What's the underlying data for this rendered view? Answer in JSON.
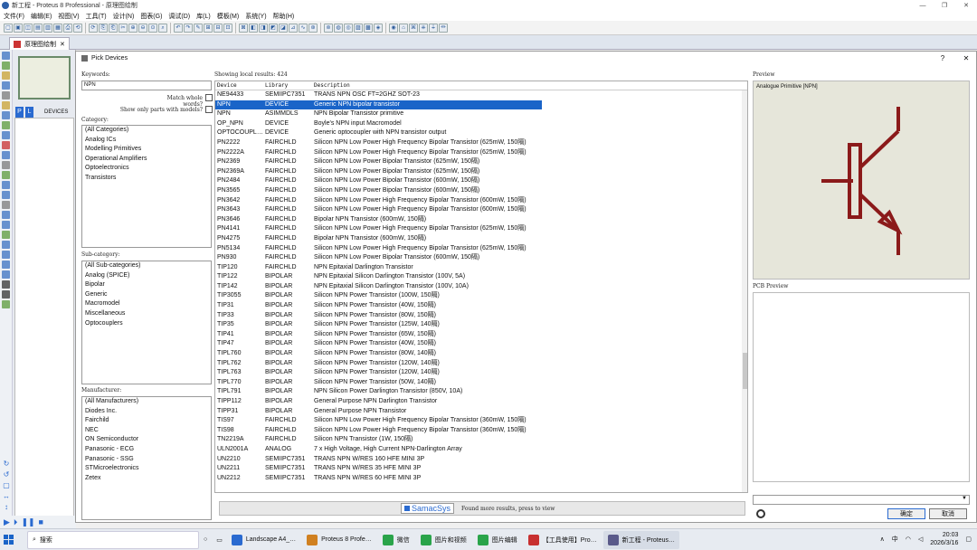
{
  "window": {
    "title": "新工程 - Proteus 8 Professional - 原理图绘制"
  },
  "menu": [
    "文件(F)",
    "编辑(E)",
    "视图(V)",
    "工具(T)",
    "设计(N)",
    "图表(G)",
    "调试(D)",
    "库(L)",
    "模板(M)",
    "系统(Y)",
    "帮助(H)"
  ],
  "tab": {
    "label": "原理图绘制"
  },
  "left": {
    "p_btn": "P",
    "l_btn": "L",
    "devices_label": "DEVICES"
  },
  "dialog": {
    "title": "Pick Devices",
    "help": "?",
    "keywords_label": "Keywords:",
    "keywords_value": "NPN",
    "match_whole": "Match whole words?",
    "show_models": "Show only parts with models?",
    "category_label": "Category:",
    "categories": [
      "(All Categories)",
      "Analog ICs",
      "Modelling Primitives",
      "Operational Amplifiers",
      "Optoelectronics",
      "Transistors"
    ],
    "subcategory_label": "Sub-category:",
    "subcategories": [
      "(All Sub-categories)",
      "Analog (SPICE)",
      "Bipolar",
      "Generic",
      "Macromodel",
      "Miscellaneous",
      "Optocouplers"
    ],
    "manufacturer_label": "Manufacturer:",
    "manufacturers": [
      "(All Manufacturers)",
      "Diodes Inc.",
      "Fairchild",
      "NEC",
      "ON Semiconductor",
      "Panasonic - ECG",
      "Panasonic - SSG",
      "STMicroelectronics",
      "Zetex"
    ],
    "results_label": "Showing local results: 424",
    "col_device": "Device",
    "col_library": "Library",
    "col_description": "Description",
    "rows": [
      [
        "NE94433",
        "SEMIIPC7351",
        "TRANS NPN OSC FT=2GHZ SOT-23"
      ],
      [
        "NPN",
        "DEVICE",
        "Generic NPN bipolar transistor"
      ],
      [
        "NPN",
        "ASIMMDLS",
        "NPN Bipolar Transistor primitive"
      ],
      [
        "OP_NPN",
        "DEVICE",
        "Boyle's NPN input Macromodel"
      ],
      [
        "OPTOCOUPL…",
        "DEVICE",
        "Generic optocoupler with NPN transistor output"
      ],
      [
        "PN2222",
        "FAIRCHLD",
        "Silicon NPN Low Power High Frequency Bipolar Transistor (625mW, 150隔)"
      ],
      [
        "PN2222A",
        "FAIRCHLD",
        "Silicon NPN Low Power High Frequency Bipolar Transistor (625mW, 150隔)"
      ],
      [
        "PN2369",
        "FAIRCHLD",
        "Silicon NPN Low Power Bipolar Transistor (625mW, 150隔)"
      ],
      [
        "PN2369A",
        "FAIRCHLD",
        "Silicon NPN Low Power Bipolar Transistor (625mW, 150隔)"
      ],
      [
        "PN2484",
        "FAIRCHLD",
        "Silicon NPN Low Power Bipolar Transistor (600mW, 150隔)"
      ],
      [
        "PN3565",
        "FAIRCHLD",
        "Silicon NPN Low Power Bipolar Transistor (600mW, 150隔)"
      ],
      [
        "PN3642",
        "FAIRCHLD",
        "Silicon NPN Low Power High Frequency Bipolar Transistor (600mW, 150隔)"
      ],
      [
        "PN3643",
        "FAIRCHLD",
        "Silicon NPN Low Power High Frequency Bipolar Transistor (600mW, 150隔)"
      ],
      [
        "PN3646",
        "FAIRCHLD",
        "Bipolar NPN Transistor (600mW, 150隔)"
      ],
      [
        "PN4141",
        "FAIRCHLD",
        "Silicon NPN Low Power High Frequency Bipolar Transistor (625mW, 150隔)"
      ],
      [
        "PN4275",
        "FAIRCHLD",
        "Bipolar NPN Transistor (600mW, 150隔)"
      ],
      [
        "PN5134",
        "FAIRCHLD",
        "Silicon NPN Low Power High Frequency Bipolar Transistor (625mW, 150隔)"
      ],
      [
        "PN930",
        "FAIRCHLD",
        "Silicon NPN Low Power Bipolar Transistor (600mW, 150隔)"
      ],
      [
        "TIP120",
        "FAIRCHLD",
        "NPN Epitaxial Darlington Transistor"
      ],
      [
        "TIP122",
        "BIPOLAR",
        "NPN Epitaxial Silicon Darlington Transistor (100V, 5A)"
      ],
      [
        "TIP142",
        "BIPOLAR",
        "NPN Epitaxial Silicon Darlington Transistor (100V, 10A)"
      ],
      [
        "TIP3055",
        "BIPOLAR",
        "Silicon NPN Power Transistor (100W, 150隔)"
      ],
      [
        "TIP31",
        "BIPOLAR",
        "Silicon NPN Power Transistor (40W, 150隔)"
      ],
      [
        "TIP33",
        "BIPOLAR",
        "Silicon NPN Power Transistor (80W, 150隔)"
      ],
      [
        "TIP35",
        "BIPOLAR",
        "Silicon NPN Power Transistor (125W, 140隔)"
      ],
      [
        "TIP41",
        "BIPOLAR",
        "Silicon NPN Power Transistor (65W, 150隔)"
      ],
      [
        "TIP47",
        "BIPOLAR",
        "Silicon NPN Power Transistor (40W, 150隔)"
      ],
      [
        "TIPL760",
        "BIPOLAR",
        "Silicon NPN Power Transistor (80W, 140隔)"
      ],
      [
        "TIPL762",
        "BIPOLAR",
        "Silicon NPN Power Transistor (120W, 140隔)"
      ],
      [
        "TIPL763",
        "BIPOLAR",
        "Silicon NPN Power Transistor (120W, 140隔)"
      ],
      [
        "TIPL770",
        "BIPOLAR",
        "Silicon NPN Power Transistor (50W, 140隔)"
      ],
      [
        "TIPL791",
        "BIPOLAR",
        "NPN Silicon Power Darlington Transistor (850V, 10A)"
      ],
      [
        "TIPP112",
        "BIPOLAR",
        "General Purpose NPN Darlington Transistor"
      ],
      [
        "TIPP31",
        "BIPOLAR",
        "General Purpose NPN Transistor"
      ],
      [
        "TIS97",
        "FAIRCHLD",
        "Silicon NPN Low Power High Frequency Bipolar Transistor (360mW, 150隔)"
      ],
      [
        "TIS98",
        "FAIRCHLD",
        "Silicon NPN Low Power High Frequency Bipolar Transistor (360mW, 150隔)"
      ],
      [
        "TN2219A",
        "FAIRCHLD",
        "Silicon NPN Transistor (1W, 150隔)"
      ],
      [
        "ULN2001A",
        "ANALOG",
        "7 x High Voltage, High Current NPN-Darlington Array"
      ],
      [
        "UN2210",
        "SEMIIPC7351",
        "TRANS NPN W/RES 160 HFE MINI 3P"
      ],
      [
        "UN2211",
        "SEMIIPC7351",
        "TRANS NPN W/RES 35 HFE MINI 3P"
      ],
      [
        "UN2212",
        "SEMIIPC7351",
        "TRANS NPN W/RES 60 HFE MINI 3P"
      ]
    ],
    "selected_row": 1,
    "samacsys_logo": "SamacSys",
    "samacsys_text": "Found more results, press to view",
    "preview_label": "Preview",
    "preview_caption": "Analogue Primitive [NPN]",
    "pcb_label": "PCB Preview",
    "ok": "确定",
    "cancel": "取消"
  },
  "taskbar": {
    "search": "搜索",
    "items": [
      "Landscape A4_…",
      "Proteus 8 Profe…",
      "微信",
      "图片和视频",
      "图片编辑",
      "【工具使用】Pro…",
      "新工程 - Proteus…"
    ],
    "ime": "中",
    "time": "20:03",
    "date": "2026/3/16"
  },
  "colors": {
    "selection": "#1a64c8",
    "symbol": "#8b1a1a",
    "preview_bg": "#e6e6da"
  }
}
